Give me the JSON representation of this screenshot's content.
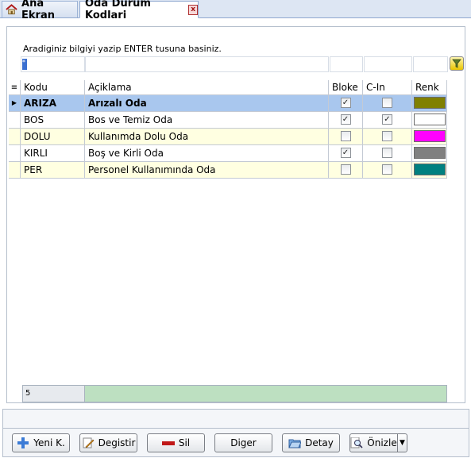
{
  "tabs": {
    "home": "Ana Ekran",
    "active": "Oda Durum Kodlari",
    "close": "x"
  },
  "search": {
    "hint": "Aradiginiz bilgiyi yazip ENTER tusuna basiniz.",
    "value": "*"
  },
  "grid": {
    "columns": [
      "Kodu",
      "Açiklama",
      "Bloke",
      "C-In",
      "Renk"
    ],
    "rows": [
      {
        "kodu": "ARIZA",
        "aciklama": "Arızalı Oda",
        "bloke": true,
        "cin": false,
        "renk": "#808000",
        "selected": true
      },
      {
        "kodu": "BOS",
        "aciklama": "Bos ve Temiz Oda",
        "bloke": true,
        "cin": true,
        "renk": "#ffffff"
      },
      {
        "kodu": "DOLU",
        "aciklama": "Kullanımda Dolu Oda",
        "bloke": false,
        "cin": false,
        "renk": "#ff00ff"
      },
      {
        "kodu": "KIRLI",
        "aciklama": "Boş ve Kirli Oda",
        "bloke": true,
        "cin": false,
        "renk": "#808080"
      },
      {
        "kodu": "PER",
        "aciklama": "Personel Kullanımında Oda",
        "bloke": false,
        "cin": false,
        "renk": "#008080"
      }
    ]
  },
  "footer": {
    "count": "5"
  },
  "buttons": {
    "new": "Yeni K.",
    "edit": "Degistir",
    "delete": "Sil",
    "other": "Diger",
    "detail": "Detay",
    "preview": "Önizle"
  },
  "colors": {
    "selected_row": "#a9c7ee",
    "alt_row": "#ffffe1",
    "count_bar": "#bde0c1"
  }
}
